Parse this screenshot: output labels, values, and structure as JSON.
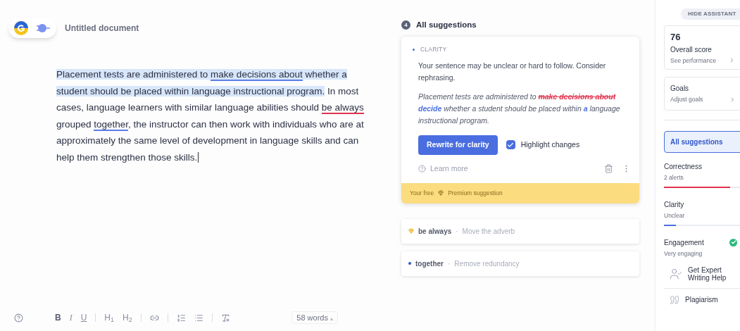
{
  "document": {
    "title": "Untitled document",
    "segments": [
      {
        "text": "Placement tests are administered to ",
        "selected": true,
        "kind": "plain"
      },
      {
        "text": "make decisions about",
        "selected": true,
        "kind": "clarity"
      },
      {
        "text": " whether a student should be placed within language instructional program.",
        "selected": true,
        "kind": "plain"
      },
      {
        "text": " In most cases, language learners with similar language abilities should ",
        "selected": false,
        "kind": "plain"
      },
      {
        "text": "be always",
        "selected": false,
        "kind": "correctness"
      },
      {
        "text": " grouped ",
        "selected": false,
        "kind": "plain"
      },
      {
        "text": "together",
        "selected": false,
        "kind": "clarity"
      },
      {
        "text": ", the instructor can then work with individuals who are at approximately the same level of development in language skills and can help them strengthen those skills.",
        "selected": false,
        "kind": "plain"
      }
    ]
  },
  "toolbar": {
    "format": [
      "B",
      "I",
      "U"
    ],
    "headings": [
      "H$_{1}$",
      "H$_{2}$"
    ],
    "word_count": "58 words",
    "word_count_caret": "▴"
  },
  "suggestions": {
    "count": "4",
    "title": "All suggestions",
    "active": {
      "category": "CLARITY",
      "message": "Your sentence may be unclear or hard to follow. Consider rephrasing.",
      "rewrite": [
        {
          "text": "Placement tests are administered to ",
          "kind": "plain"
        },
        {
          "text": "make decisions about",
          "kind": "deleted"
        },
        {
          "text": " decide",
          "kind": "inserted"
        },
        {
          "text": " whether a student should be placed within ",
          "kind": "plain"
        },
        {
          "text": "a",
          "kind": "inserted"
        },
        {
          "text": " language instructional program.",
          "kind": "plain"
        }
      ],
      "button": "Rewrite for clarity",
      "highlight": {
        "label": "Highlight changes",
        "checked": true
      },
      "learn_more": "Learn more",
      "premium": {
        "prefix": "Your free",
        "label": "Premium suggestion"
      }
    },
    "items": [
      {
        "phrase": "be always",
        "separator": "·",
        "hint": "Move the adverb",
        "kind": "premium"
      },
      {
        "phrase": "together",
        "separator": "·",
        "hint": "Remove redundancy",
        "kind": "clarity"
      }
    ]
  },
  "sidebar": {
    "hide_button": "HIDE ASSISTANT",
    "score": {
      "value": "76",
      "label": "Overall score",
      "link": "See performance"
    },
    "goals": {
      "label": "Goals",
      "link": "Adjust goals"
    },
    "all": {
      "label": "All suggestions",
      "selected": true
    },
    "categories": [
      {
        "name": "Correctness",
        "status": "2 alerts",
        "level": 0.85,
        "color": "#e0344f",
        "done": false
      },
      {
        "name": "Clarity",
        "status": "Unclear",
        "level": 0.15,
        "color": "#4a6ee0",
        "done": false
      },
      {
        "name": "Engagement",
        "status": "Very engaging",
        "done": true
      }
    ],
    "expert": "Get Expert Writing Help",
    "plagiarism": "Plagiarism"
  }
}
